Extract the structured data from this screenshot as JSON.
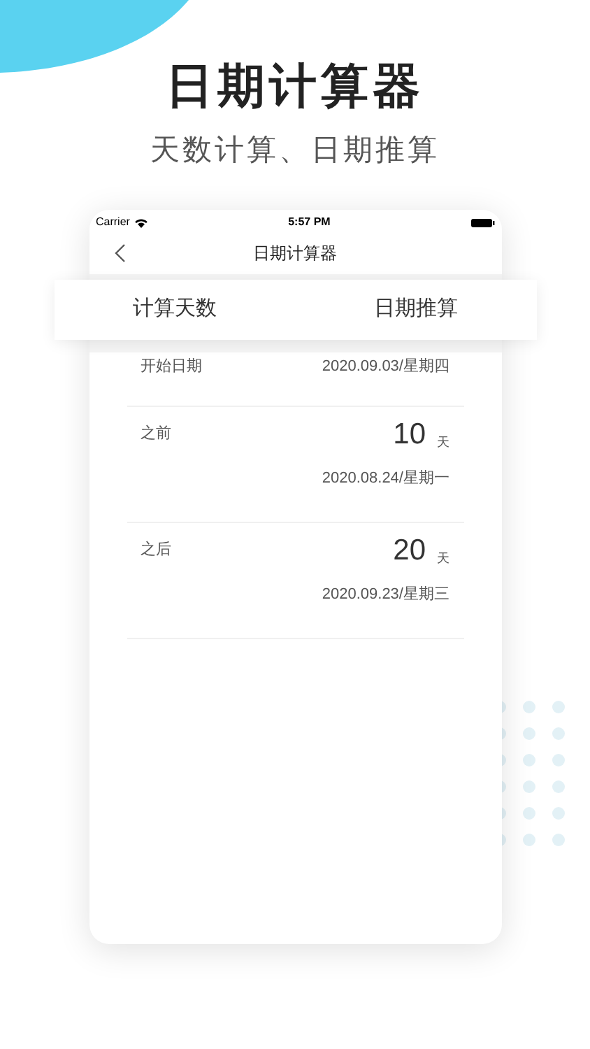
{
  "headline": "日期计算器",
  "subtitle": "天数计算、日期推算",
  "status_bar": {
    "carrier": "Carrier",
    "time": "5:57 PM"
  },
  "nav": {
    "title": "日期计算器"
  },
  "tabs": [
    {
      "label": "计算天数"
    },
    {
      "label": "日期推算"
    }
  ],
  "start": {
    "label": "开始日期",
    "value": "2020.09.03/星期四"
  },
  "results": [
    {
      "label": "之前",
      "days": "10",
      "unit": "天",
      "date": "2020.08.24/星期一"
    },
    {
      "label": "之后",
      "days": "20",
      "unit": "天",
      "date": "2020.09.23/星期三"
    }
  ]
}
